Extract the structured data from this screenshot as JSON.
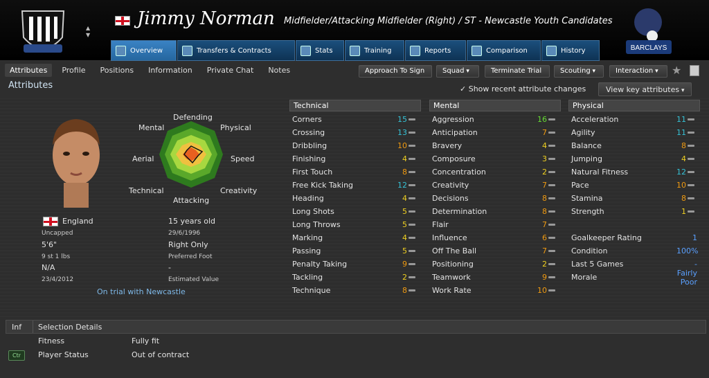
{
  "header": {
    "player_name": "Jimmy Norman",
    "role": "Midfielder/Attacking Midfielder (Right) / ST - Newcastle Youth Candidates"
  },
  "tabs": [
    {
      "label": "Overview",
      "icon": "overview-icon"
    },
    {
      "label": "Transfers & Contracts",
      "icon": "contract-icon"
    },
    {
      "label": "Stats",
      "icon": "stats-icon"
    },
    {
      "label": "Training",
      "icon": "training-icon"
    },
    {
      "label": "Reports",
      "icon": "reports-icon"
    },
    {
      "label": "Comparison",
      "icon": "comparison-icon"
    },
    {
      "label": "History",
      "icon": "history-icon"
    }
  ],
  "subtabs": [
    "Attributes",
    "Profile",
    "Positions",
    "Information",
    "Private Chat",
    "Notes"
  ],
  "actions": {
    "approach": "Approach To Sign",
    "squad": "Squad",
    "terminate": "Terminate Trial",
    "scouting": "Scouting",
    "interaction": "Interaction"
  },
  "attributes_title": "Attributes",
  "recent_changes": "Show recent attribute changes",
  "view_key": "View key attributes",
  "radar": {
    "defending": "Defending",
    "physical": "Physical",
    "speed": "Speed",
    "creativity": "Creativity",
    "attacking": "Attacking",
    "technical": "Technical",
    "aerial": "Aerial",
    "mental": "Mental"
  },
  "player": {
    "nation": "England",
    "caps": "Uncapped",
    "height": "5'6\"",
    "weight": "9 st 1 lbs",
    "value": "N/A",
    "date": "23/4/2012",
    "age": "15 years old",
    "dob": "29/6/1996",
    "foot": "Right Only",
    "foot_label": "Preferred Foot",
    "value_dash": "-",
    "value_label": "Estimated Value",
    "trial": "On trial with Newcastle"
  },
  "technical": {
    "header": "Technical",
    "rows": [
      {
        "name": "Corners",
        "value": "15",
        "color": "#35c2d6"
      },
      {
        "name": "Crossing",
        "value": "13",
        "color": "#35c2d6"
      },
      {
        "name": "Dribbling",
        "value": "10",
        "color": "#f09a10"
      },
      {
        "name": "Finishing",
        "value": "4",
        "color": "#f0d020"
      },
      {
        "name": "First Touch",
        "value": "8",
        "color": "#f09a10"
      },
      {
        "name": "Free Kick Taking",
        "value": "12",
        "color": "#35c2d6"
      },
      {
        "name": "Heading",
        "value": "4",
        "color": "#f0d020"
      },
      {
        "name": "Long Shots",
        "value": "5",
        "color": "#f0d020"
      },
      {
        "name": "Long Throws",
        "value": "5",
        "color": "#f0d020"
      },
      {
        "name": "Marking",
        "value": "4",
        "color": "#f0d020"
      },
      {
        "name": "Passing",
        "value": "5",
        "color": "#f0d020"
      },
      {
        "name": "Penalty Taking",
        "value": "9",
        "color": "#f09a10"
      },
      {
        "name": "Tackling",
        "value": "2",
        "color": "#f0d020"
      },
      {
        "name": "Technique",
        "value": "8",
        "color": "#f09a10"
      }
    ]
  },
  "mental": {
    "header": "Mental",
    "rows": [
      {
        "name": "Aggression",
        "value": "16",
        "color": "#66dd33"
      },
      {
        "name": "Anticipation",
        "value": "7",
        "color": "#f09a10"
      },
      {
        "name": "Bravery",
        "value": "4",
        "color": "#f0d020"
      },
      {
        "name": "Composure",
        "value": "3",
        "color": "#f0d020"
      },
      {
        "name": "Concentration",
        "value": "2",
        "color": "#f0d020"
      },
      {
        "name": "Creativity",
        "value": "7",
        "color": "#f09a10"
      },
      {
        "name": "Decisions",
        "value": "8",
        "color": "#f09a10"
      },
      {
        "name": "Determination",
        "value": "8",
        "color": "#f09a10"
      },
      {
        "name": "Flair",
        "value": "7",
        "color": "#f09a10"
      },
      {
        "name": "Influence",
        "value": "6",
        "color": "#f09a10"
      },
      {
        "name": "Off The Ball",
        "value": "7",
        "color": "#f09a10"
      },
      {
        "name": "Positioning",
        "value": "2",
        "color": "#f0d020"
      },
      {
        "name": "Teamwork",
        "value": "9",
        "color": "#f09a10"
      },
      {
        "name": "Work Rate",
        "value": "10",
        "color": "#f09a10"
      }
    ]
  },
  "physical": {
    "header": "Physical",
    "rows": [
      {
        "name": "Acceleration",
        "value": "11",
        "color": "#35c2d6"
      },
      {
        "name": "Agility",
        "value": "11",
        "color": "#35c2d6"
      },
      {
        "name": "Balance",
        "value": "8",
        "color": "#f09a10"
      },
      {
        "name": "Jumping",
        "value": "4",
        "color": "#f0d020"
      },
      {
        "name": "Natural Fitness",
        "value": "12",
        "color": "#35c2d6"
      },
      {
        "name": "Pace",
        "value": "10",
        "color": "#f09a10"
      },
      {
        "name": "Stamina",
        "value": "8",
        "color": "#f09a10"
      },
      {
        "name": "Strength",
        "value": "1",
        "color": "#f0d020"
      }
    ],
    "extra": [
      {
        "name": "Goalkeeper Rating",
        "value": "1"
      },
      {
        "name": "Condition",
        "value": "100%"
      },
      {
        "name": "Last 5 Games",
        "value": "-"
      },
      {
        "name": "Morale",
        "value": "Fairly Poor"
      }
    ]
  },
  "selection": {
    "inf": "Inf",
    "title": "Selection Details",
    "fitness_label": "Fitness",
    "fitness": "Fully fit",
    "status_label": "Player Status",
    "status": "Out of contract",
    "ctr": "Ctr"
  }
}
